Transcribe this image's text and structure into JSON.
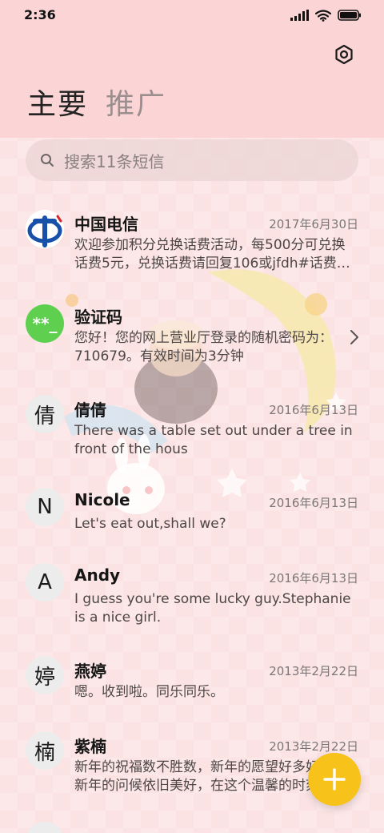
{
  "status_bar": {
    "time": "2:36",
    "icons": [
      "signal-icon",
      "wifi-icon",
      "battery-icon"
    ]
  },
  "header": {
    "settings_icon": "settings-icon",
    "tabs": [
      {
        "label": "主要",
        "active": true
      },
      {
        "label": "推广",
        "active": false
      }
    ]
  },
  "search": {
    "placeholder": "搜索11条短信"
  },
  "messages": [
    {
      "avatar": "",
      "avatar_type": "china-telecom-logo",
      "sender": "中国电信",
      "date": "2017年6月30日",
      "snippet": "欢迎参加积分兑换话费活动，每500分可兑换话费5元，兑换话费请回复106或jfdh#话费…"
    },
    {
      "avatar": "**_",
      "avatar_type": "verification-code",
      "sender": "验证码",
      "date": "",
      "snippet": "您好！您的网上营业厅登录的随机密码为：710679。有效时间为3分钟"
    },
    {
      "avatar": "倩",
      "avatar_type": "initial",
      "sender": "倩倩",
      "date": "2016年6月13日",
      "snippet": "There was a table set out under a tree in front of the hous"
    },
    {
      "avatar": "N",
      "avatar_type": "initial",
      "sender": "Nicole",
      "date": "2016年6月13日",
      "snippet": "Let's eat out,shall we?"
    },
    {
      "avatar": "A",
      "avatar_type": "initial",
      "sender": "Andy",
      "date": "2016年6月13日",
      "snippet": "I guess you're some lucky guy.Stephanie is a nice girl."
    },
    {
      "avatar": "婷",
      "avatar_type": "initial",
      "sender": "燕婷",
      "date": "2013年2月22日",
      "snippet": "嗯。收到啦。同乐同乐。"
    },
    {
      "avatar": "楠",
      "avatar_type": "initial",
      "sender": "紫楠",
      "date": "2013年2月22日",
      "snippet": "新年的祝福数不胜数，新年的愿望好多好多，新年的问候依旧美好，在这个温馨的时刻"
    }
  ],
  "fab": {
    "icon": "plus-icon"
  },
  "colors": {
    "header_bg": "#fbd5d5",
    "page_bg": "#fbe3e3",
    "fab": "#f7c21a",
    "verification_avatar": "#5fcf4f",
    "telecom_blue": "#1750a8"
  }
}
